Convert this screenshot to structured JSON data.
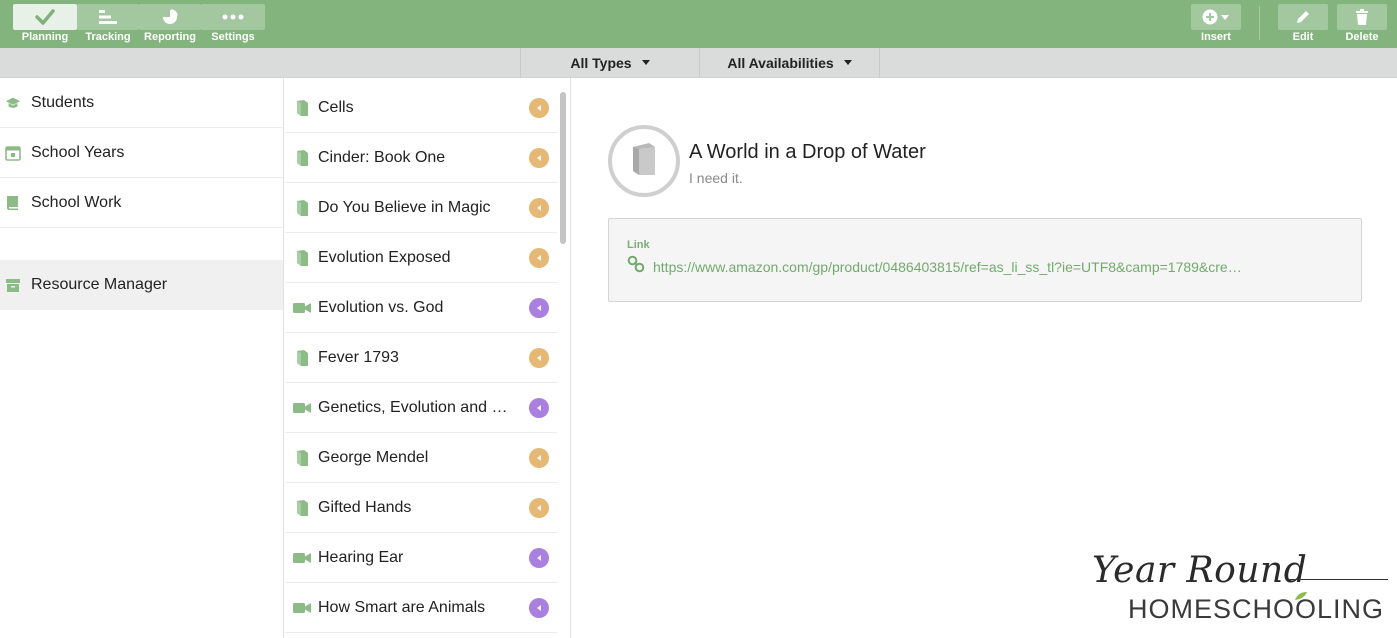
{
  "toolbar": {
    "left_buttons": [
      {
        "label": "Planning",
        "icon": "check-icon"
      },
      {
        "label": "Tracking",
        "icon": "bars-icon"
      },
      {
        "label": "Reporting",
        "icon": "pie-chart-icon"
      },
      {
        "label": "Settings",
        "icon": "more-dots-icon"
      }
    ],
    "right_buttons": [
      {
        "label": "Insert",
        "icon": "plus-circle-icon"
      },
      {
        "label": "Edit",
        "icon": "pencil-icon"
      },
      {
        "label": "Delete",
        "icon": "trash-icon"
      }
    ],
    "active": "Planning"
  },
  "filters": {
    "types": "All Types",
    "availabilities": "All Availabilities"
  },
  "nav": {
    "items": [
      {
        "label": "Students",
        "icon": "graduation-cap-icon"
      },
      {
        "label": "School Years",
        "icon": "calendar-icon"
      },
      {
        "label": "School Work",
        "icon": "book-icon"
      },
      {
        "label": "Resource Manager",
        "icon": "box-icon"
      }
    ],
    "selected": "Resource Manager"
  },
  "resources": {
    "items": [
      {
        "label": "Cells",
        "type": "book"
      },
      {
        "label": "Cinder: Book One",
        "type": "book"
      },
      {
        "label": "Do You Believe in Magic",
        "type": "book"
      },
      {
        "label": "Evolution Exposed",
        "type": "book"
      },
      {
        "label": "Evolution vs. God",
        "type": "video"
      },
      {
        "label": "Fever 1793",
        "type": "book"
      },
      {
        "label": "Genetics, Evolution and …",
        "type": "video"
      },
      {
        "label": "George Mendel",
        "type": "book"
      },
      {
        "label": "Gifted Hands",
        "type": "book"
      },
      {
        "label": "Hearing Ear",
        "type": "video"
      },
      {
        "label": "How Smart are Animals",
        "type": "video"
      }
    ],
    "badge_colors": {
      "book": "#e5b875",
      "video": "#a97fe0"
    }
  },
  "detail": {
    "title": "A World in a Drop of Water",
    "subtitle": "I need it.",
    "link_label": "Link",
    "link_url": "https://www.amazon.com/gp/product/0486403815/ref=as_li_ss_tl?ie=UTF8&camp=1789&cre…"
  },
  "watermark": {
    "line1": "Year Round",
    "line2": "HOMESCHOOLING"
  },
  "colors": {
    "toolbar": "#83b47e",
    "accent_green": "#7fb17a",
    "link_green": "#72aa6d"
  }
}
